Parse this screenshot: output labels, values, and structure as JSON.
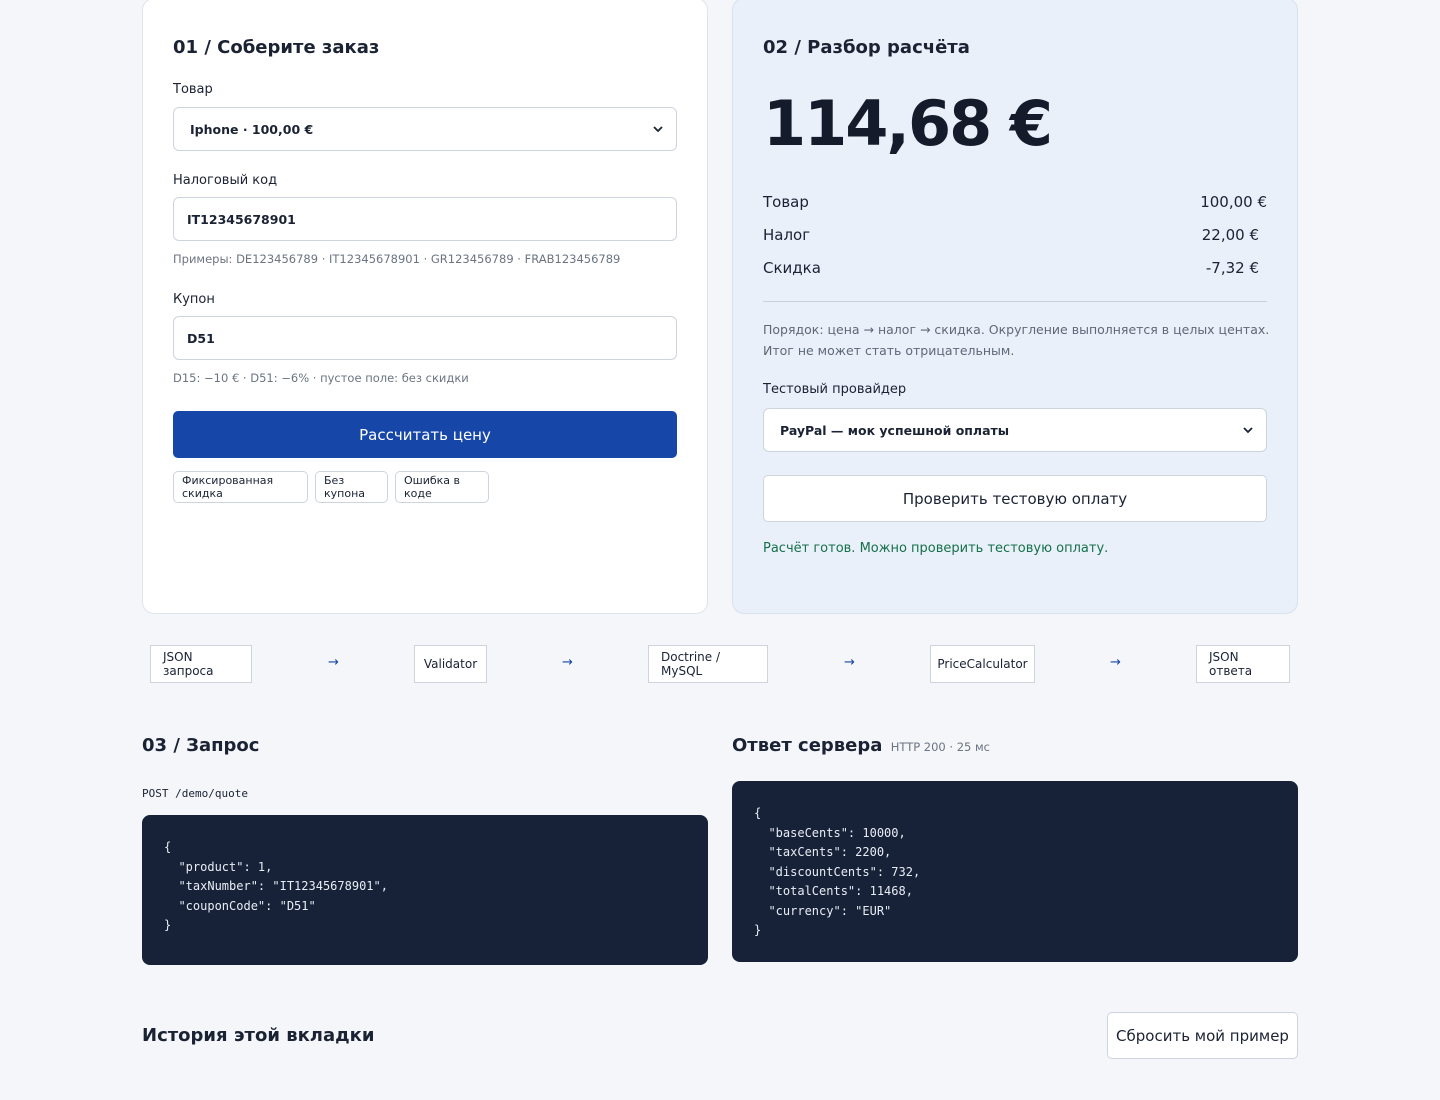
{
  "order_panel": {
    "title": "01 / Соберите заказ",
    "product_label": "Товар",
    "product_selected": "Iphone · 100,00 €",
    "tax_label": "Налоговый код",
    "tax_value": "IT12345678901",
    "tax_hint": "Примеры: DE123456789 · IT12345678901 · GR123456789 · FRAB123456789",
    "coupon_label": "Купон",
    "coupon_value": "D51",
    "coupon_hint": "D15: −10 € · D51: −6% · пустое поле: без скидки",
    "calculate_button": "Рассчитать цену",
    "presets": [
      "Фиксированная скидка",
      "Без купона",
      "Ошибка в коде"
    ]
  },
  "breakdown_panel": {
    "title": "02 / Разбор расчёта",
    "total": "114,68 €",
    "rows": [
      {
        "label": "Товар",
        "value": "100,00 €"
      },
      {
        "label": "Налог",
        "value": "22,00 €"
      },
      {
        "label": "Скидка",
        "value": "-7,32 €"
      }
    ],
    "note": "Порядок: цена → налог → скидка. Округление выполняется в целых центах. Итог не может стать отрицательным.",
    "provider_label": "Тестовый провайдер",
    "provider_selected": "PayPal — мок успешной оплаты",
    "check_button": "Проверить тестовую оплату",
    "status": "Расчёт готов. Можно проверить тестовую оплату.",
    "status_color": "#16704a"
  },
  "flow": {
    "steps": [
      "JSON запроса",
      "Validator",
      "Doctrine / MySQL",
      "PriceCalculator",
      "JSON ответа"
    ],
    "arrow": "→"
  },
  "request": {
    "title": "03 / Запрос",
    "endpoint": "POST /demo/quote",
    "body": "{\n  \"product\": 1,\n  \"taxNumber\": \"IT12345678901\",\n  \"couponCode\": \"D51\"\n}"
  },
  "response": {
    "title": "Ответ сервера",
    "meta": "HTTP 200 · 25 мс",
    "body": "{\n  \"baseCents\": 10000,\n  \"taxCents\": 2200,\n  \"discountCents\": 732,\n  \"totalCents\": 11468,\n  \"currency\": \"EUR\"\n}"
  },
  "history": {
    "title": "История этой вкладки",
    "reset_button": "Сбросить мой пример"
  },
  "colors": {
    "accent": "#1646a8",
    "code_bg": "#172238",
    "page_bg": "#f4f6fa"
  }
}
